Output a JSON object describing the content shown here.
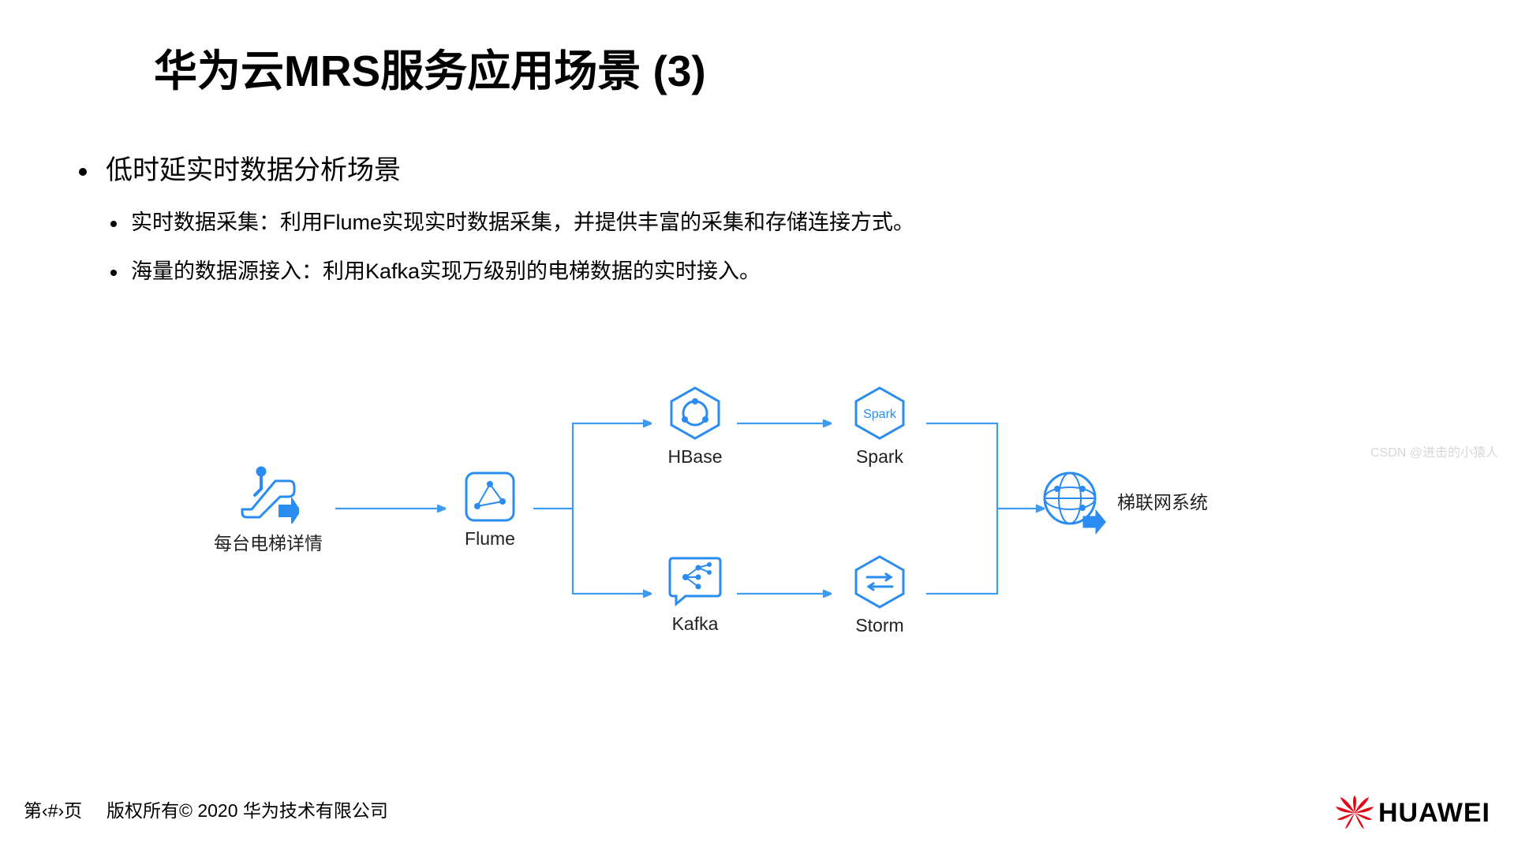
{
  "title": "华为云MRS服务应用场景 (3)",
  "bullets": {
    "l1": "低时延实时数据分析场景",
    "l2a": "实时数据采集：利用Flume实现实时数据采集，并提供丰富的采集和存储连接方式。",
    "l2b": "海量的数据源接入：利用Kafka实现万级别的电梯数据的实时接入。"
  },
  "nodes": {
    "elevator": "每台电梯详情",
    "flume": "Flume",
    "hbase": "HBase",
    "kafka": "Kafka",
    "spark": "Spark",
    "storm": "Storm",
    "system": "梯联网系统"
  },
  "footer": {
    "page": "第‹#›页",
    "copyright": "版权所有© 2020 华为技术有限公司",
    "brand": "HUAWEI"
  },
  "watermark": "CSDN @进击的小猿人",
  "colors": {
    "accent": "#2a8cf0",
    "line": "#3d9bf2"
  }
}
